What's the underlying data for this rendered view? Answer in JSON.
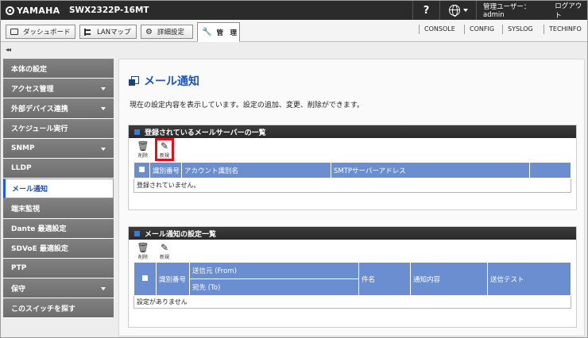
{
  "header": {
    "brand": "YAMAHA",
    "model": "SWX2322P-16MT",
    "help": "?",
    "user_label": "管理ユーザー：admin",
    "logout_label": "ログアウト"
  },
  "tabs": [
    {
      "label": "ダッシュボード"
    },
    {
      "label": "LANマップ"
    },
    {
      "label": "詳細設定"
    },
    {
      "label": "管　理"
    }
  ],
  "top_links": [
    "CONSOLE",
    "CONFIG",
    "SYSLOG",
    "TECHINFO"
  ],
  "collapse_label": "◂◂",
  "sidebar": {
    "items": [
      {
        "label": "本体の設定"
      },
      {
        "label": "アクセス管理"
      },
      {
        "label": "外部デバイス連携"
      },
      {
        "label": "スケジュール実行"
      },
      {
        "label": "SNMP"
      },
      {
        "label": "LLDP"
      },
      {
        "label": "メール通知"
      },
      {
        "label": "端末監視"
      },
      {
        "label": "Dante 最適設定"
      },
      {
        "label": "SDVoE 最適設定"
      },
      {
        "label": "PTP"
      },
      {
        "label": "保守"
      },
      {
        "label": "このスイッチを探す"
      }
    ]
  },
  "main": {
    "title": "メール通知",
    "description": "現在の設定内容を表示しています。設定の追加、変更、削除ができます。",
    "server_panel": {
      "title": "登録されているメールサーバーの一覧",
      "delete_label": "削除",
      "new_label": "新規",
      "columns": [
        "識別番号",
        "アカウント識別名",
        "SMTPサーバーアドレス"
      ],
      "empty_text": "登録されていません。"
    },
    "setting_panel": {
      "title": "メール通知の設定一覧",
      "delete_label": "削除",
      "new_label": "新規",
      "col_id": "識別番号",
      "col_from": "送信元 (From)",
      "col_to": "宛先 (To)",
      "col_subject": "件名",
      "col_content": "通知内容",
      "col_test": "送信テスト",
      "empty_text": "設定がありません"
    }
  },
  "colors": {
    "accent_blue": "#1a56c4",
    "table_header": "#6b8ed0",
    "highlight_red": "#e0101a",
    "topbar": "#2b2b2b"
  }
}
